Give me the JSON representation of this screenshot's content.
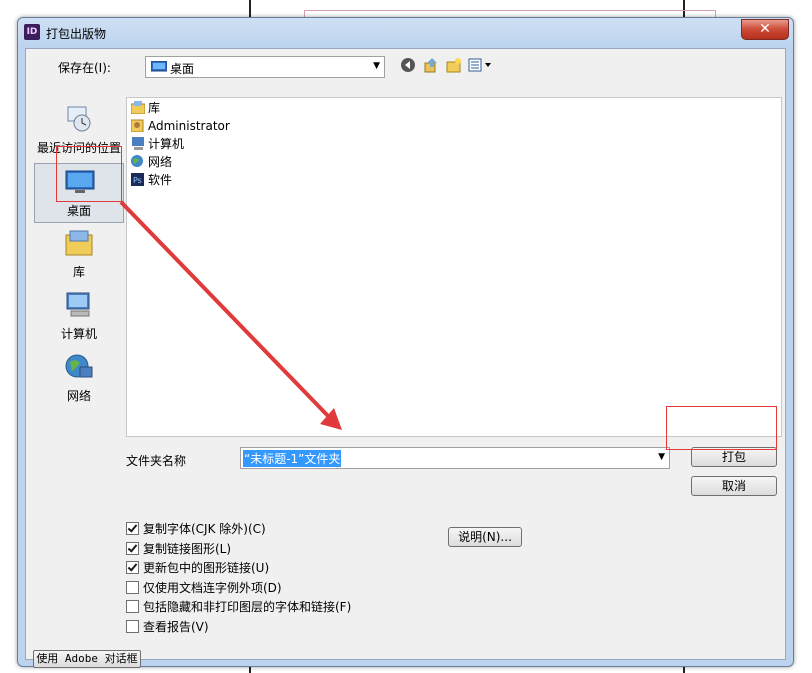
{
  "window": {
    "title": "打包出版物",
    "app_icon": "ID",
    "close_glyph": "✕"
  },
  "toolbar": {
    "save_in_label": "保存在(I):",
    "location_value": "桌面",
    "icons": [
      "back-icon",
      "up-folder-icon",
      "new-folder-icon",
      "view-menu-icon"
    ]
  },
  "places": [
    {
      "label": "最近访问的位置",
      "icon": "recent-places-icon"
    },
    {
      "label": "桌面",
      "icon": "desktop-icon",
      "selected": true
    },
    {
      "label": "库",
      "icon": "libraries-icon"
    },
    {
      "label": "计算机",
      "icon": "computer-icon"
    },
    {
      "label": "网络",
      "icon": "network-icon"
    }
  ],
  "files": [
    {
      "name": "库",
      "icon": "libraries-icon"
    },
    {
      "name": "Administrator",
      "icon": "user-folder-icon"
    },
    {
      "name": "计算机",
      "icon": "computer-icon"
    },
    {
      "name": "网络",
      "icon": "network-icon"
    },
    {
      "name": "软件",
      "icon": "photoshop-icon"
    }
  ],
  "folder_name": {
    "label": "文件夹名称",
    "value": "“未标题-1”文件夹"
  },
  "buttons": {
    "package": "打包",
    "cancel": "取消",
    "instructions": "说明(N)...",
    "use_adobe_dialog": "使用 Adobe 对话框"
  },
  "options": [
    {
      "label": "复制字体(CJK 除外)(C)",
      "checked": true
    },
    {
      "label": "复制链接图形(L)",
      "checked": true
    },
    {
      "label": "更新包中的图形链接(U)",
      "checked": true
    },
    {
      "label": "仅使用文档连字例外项(D)",
      "checked": false
    },
    {
      "label": "包括隐藏和非打印图层的字体和链接(F)",
      "checked": false
    },
    {
      "label": "查看报告(V)",
      "checked": false
    }
  ],
  "colors": {
    "annotation_red": "#e03a3a",
    "selection_blue": "#3399ff"
  }
}
